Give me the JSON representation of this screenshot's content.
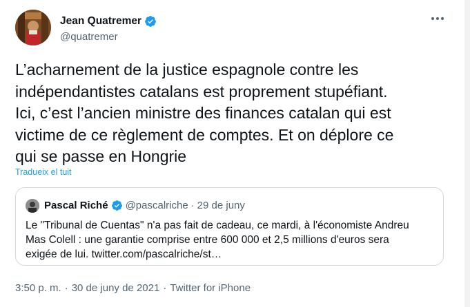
{
  "tweet": {
    "author": {
      "name": "Jean Quatremer",
      "handle": "@quatremer",
      "verified_icon": "verified-badge-icon"
    },
    "more_icon": "more-icon",
    "text": "L’acharnement de la justice espagnole contre les\nindépendantistes catalans est proprement stupéfiant.\nIci, c’est l’ancien ministre des finances catalan qui est\nvictime de ce règlement de comptes. Et on déplore ce\nqui se passe en Hongrie",
    "translate_label": "Tradueix el tuit",
    "quote": {
      "author_name": "Pascal Riché",
      "author_handle": "@pascalriche",
      "separator": "·",
      "date": "29 de juny",
      "text": "Le \"Tribunal de Cuentas\" n'a pas fait de cadeau, ce mardi,  à l'économiste Andreu\nMas Colell : une garantie comprise entre 600 000 et 2,5 millions d'euros sera\nexigée de lui. twitter.com/pascalriche/st…"
    },
    "meta": {
      "time": "3:50 p. m.",
      "separator": "·",
      "date": "30 de juny de 2021",
      "source": "Twitter for iPhone"
    }
  },
  "colors": {
    "accent": "#1d9bf0",
    "text": "#0f1419",
    "secondary": "#536471",
    "border": "#cfd9de"
  }
}
